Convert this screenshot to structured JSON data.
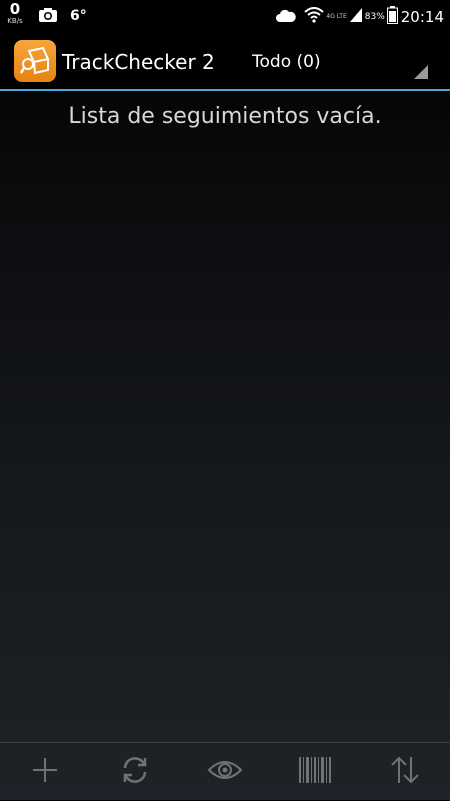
{
  "status_bar": {
    "net_speed": "0",
    "net_speed_unit": "KB/s",
    "temperature": "6°",
    "network_type": "4G LTE",
    "battery_percent": "83%",
    "time": "20:14",
    "icons": [
      "camera-icon",
      "cloud-icon",
      "wifi-icon",
      "signal-icon",
      "battery-icon"
    ]
  },
  "action_bar": {
    "app_title": "TrackChecker 2",
    "filter_label": "Todo (0)",
    "accent_color": "#4aa6d8",
    "icon_color": "#ef9224"
  },
  "main": {
    "empty_message": "Lista de seguimientos vacía."
  },
  "bottom_bar": {
    "buttons": [
      {
        "icon": "add-icon"
      },
      {
        "icon": "refresh-icon"
      },
      {
        "icon": "eye-icon"
      },
      {
        "icon": "barcode-icon"
      },
      {
        "icon": "sort-icon"
      }
    ]
  }
}
